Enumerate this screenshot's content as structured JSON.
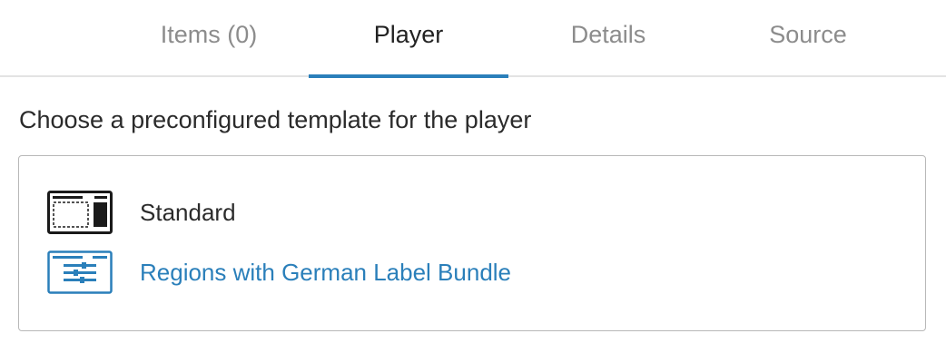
{
  "tabs": [
    {
      "label": "Items (0)",
      "active": false
    },
    {
      "label": "Player",
      "active": true
    },
    {
      "label": "Details",
      "active": false
    },
    {
      "label": "Source",
      "active": false
    }
  ],
  "main": {
    "heading": "Choose a preconfigured template for the player",
    "templates": [
      {
        "label": "Standard",
        "icon": "standard-layout-icon",
        "selected": false
      },
      {
        "label": "Regions with German Label Bundle",
        "icon": "regions-layout-icon",
        "selected": true
      }
    ]
  },
  "colors": {
    "accent": "#2a7fba",
    "text": "#2b2b2b",
    "inactive_tab": "#8c8c8c",
    "border": "#b8b8b8"
  }
}
